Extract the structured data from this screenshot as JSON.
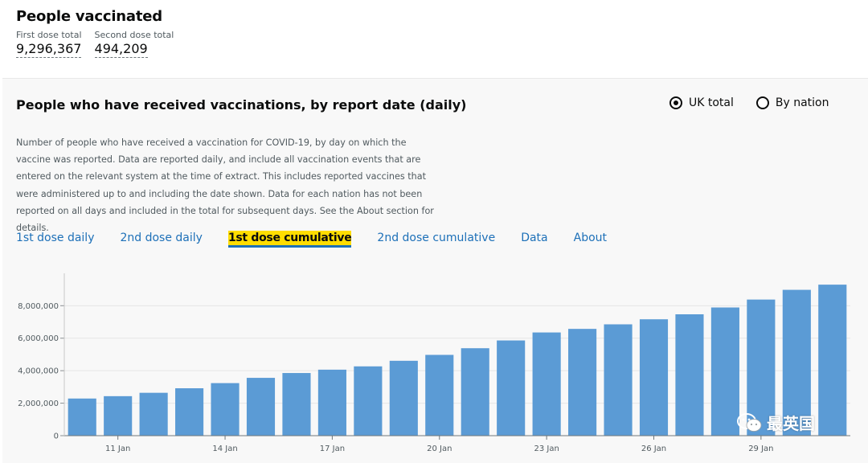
{
  "summary": {
    "title": "People vaccinated",
    "first_dose_label": "First dose total",
    "first_dose_value": "9,296,367",
    "second_dose_label": "Second dose total",
    "second_dose_value": "494,209"
  },
  "card": {
    "title": "People who have received vaccinations, by report date (daily)",
    "description": "Number of people who have received a vaccination for COVID-19, by day on which the vaccine was reported. Data are reported daily, and include all vaccination events that are entered on the relevant system at the time of extract. This includes reported vaccines that were administered up to and including the date shown. Data for each nation has not been reported on all days and included in the total for subsequent days. See the About section for details.",
    "radios": [
      {
        "label": "UK total",
        "checked": true
      },
      {
        "label": "By nation",
        "checked": false
      }
    ],
    "tabs": [
      {
        "label": "1st dose daily",
        "active": false
      },
      {
        "label": "2nd dose daily",
        "active": false
      },
      {
        "label": "1st dose cumulative",
        "active": true
      },
      {
        "label": "2nd dose cumulative",
        "active": false
      },
      {
        "label": "Data",
        "active": false
      },
      {
        "label": "About",
        "active": false
      }
    ]
  },
  "chart_data": {
    "type": "bar",
    "title": "",
    "xlabel": "",
    "ylabel": "",
    "color": "#5b9bd5",
    "grid": true,
    "ylim": [
      0,
      9500000
    ],
    "yticks": [
      0,
      2000000,
      4000000,
      6000000,
      8000000
    ],
    "ytick_labels": [
      "0",
      "2,000,000",
      "4,000,000",
      "6,000,000",
      "8,000,000"
    ],
    "categories": [
      "10 Jan",
      "11 Jan",
      "12 Jan",
      "13 Jan",
      "14 Jan",
      "15 Jan",
      "16 Jan",
      "17 Jan",
      "18 Jan",
      "19 Jan",
      "20 Jan",
      "21 Jan",
      "22 Jan",
      "23 Jan",
      "24 Jan",
      "25 Jan",
      "26 Jan",
      "27 Jan",
      "28 Jan",
      "29 Jan",
      "30 Jan",
      "31 Jan"
    ],
    "xtick_labels": [
      "",
      "11 Jan",
      "",
      "",
      "14 Jan",
      "",
      "",
      "17 Jan",
      "",
      "",
      "20 Jan",
      "",
      "",
      "23 Jan",
      "",
      "",
      "26 Jan",
      "",
      "",
      "29 Jan",
      "",
      ""
    ],
    "values": [
      2286572,
      2431648,
      2639309,
      2918252,
      3234946,
      3559179,
      3857266,
      4062501,
      4266577,
      4609740,
      4973248,
      5383103,
      5861351,
      6353321,
      6573570,
      6853327,
      7164387,
      7471224,
      7891184,
      8378940,
      8977329,
      9296367
    ]
  },
  "watermark": {
    "text": "最英国",
    "icon": "wechat-icon"
  }
}
